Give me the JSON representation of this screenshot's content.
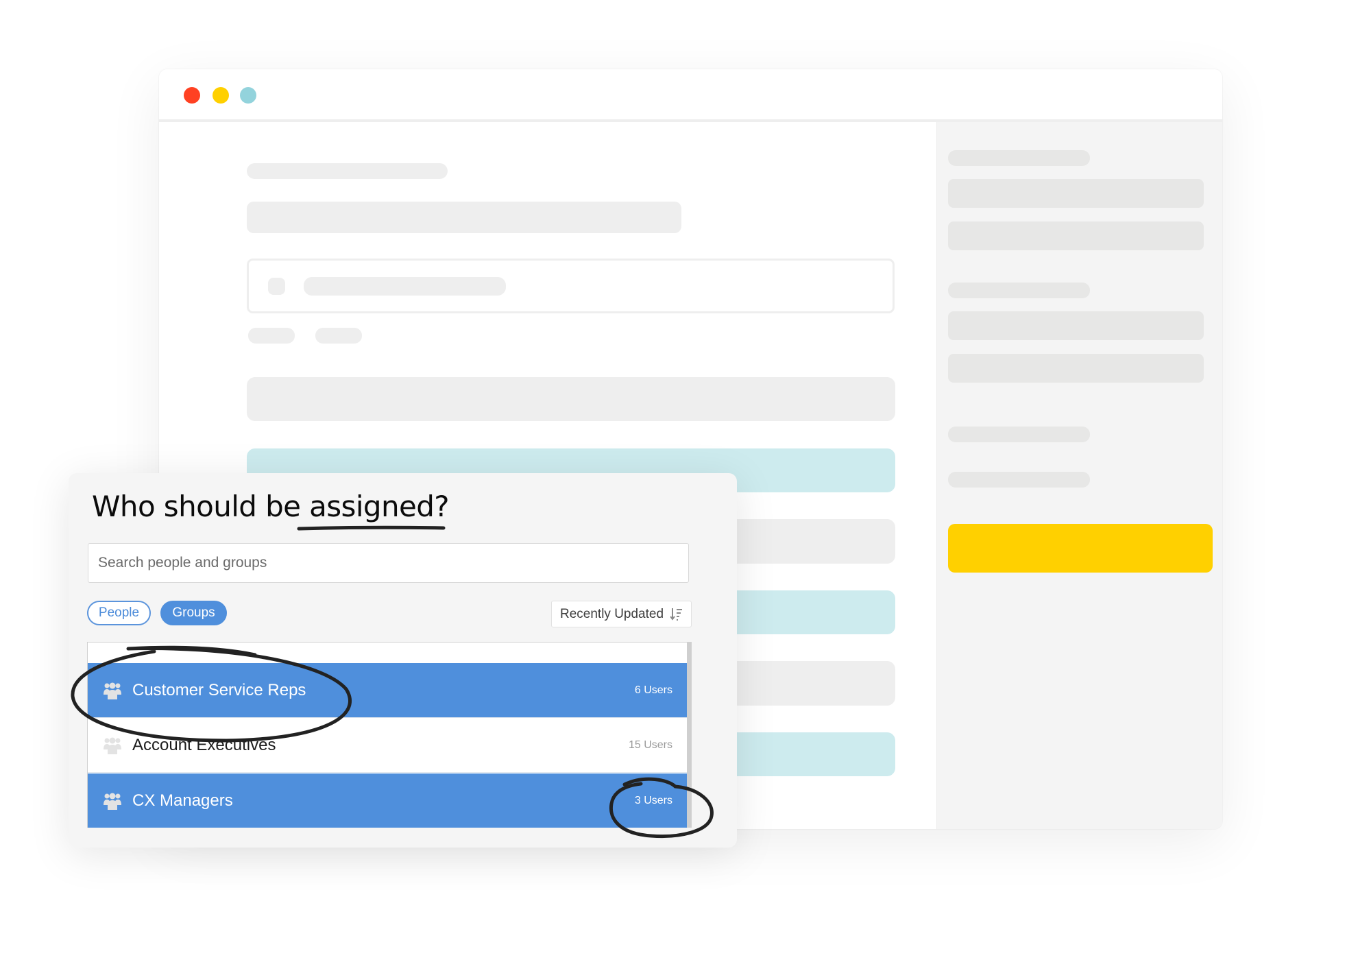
{
  "window": {
    "traffic_lights": [
      {
        "name": "close",
        "color": "#ff4122"
      },
      {
        "name": "minimize",
        "color": "#ffd000"
      },
      {
        "name": "zoom",
        "color": "#93d3dc"
      }
    ]
  },
  "colors": {
    "accent_blue": "#4f8fdc",
    "action_yellow": "#ffd000",
    "skeleton_grey": "#eeeeee",
    "skeleton_teal": "#cdebee",
    "annotation_ink": "#222222"
  },
  "assign_card": {
    "heading": "Who should be assigned?",
    "emphasized_word": "assigned",
    "search": {
      "value": "",
      "placeholder": "Search people and groups"
    },
    "filters": [
      {
        "label": "People",
        "active": false
      },
      {
        "label": "Groups",
        "active": true
      }
    ],
    "sort": {
      "label": "Recently Updated",
      "icon": "sort-descending-icon"
    },
    "groups": [
      {
        "name": "Customer Service Reps",
        "count": "6 Users",
        "selected": true,
        "icon": "group-icon"
      },
      {
        "name": "Account Executives",
        "count": "15 Users",
        "selected": false,
        "icon": "group-icon"
      },
      {
        "name": "CX Managers",
        "count": "3 Users",
        "selected": true,
        "icon": "group-icon"
      }
    ],
    "annotations": [
      {
        "type": "circle",
        "target": "Customer Service Reps"
      },
      {
        "type": "circle",
        "target": "3 Users"
      },
      {
        "type": "underline",
        "target": "assigned"
      }
    ]
  }
}
